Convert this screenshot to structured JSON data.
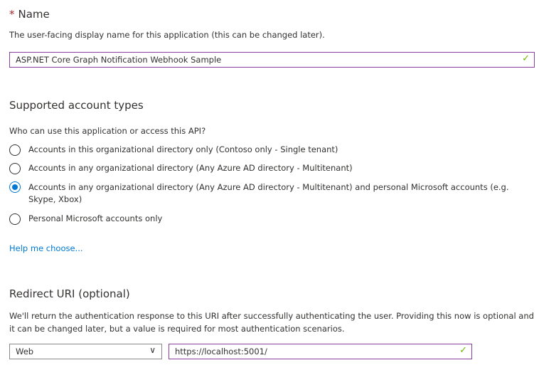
{
  "name_section": {
    "required_mark": "*",
    "title": "Name",
    "description": "The user-facing display name for this application (this can be changed later).",
    "value": "ASP.NET Core Graph Notification Webhook Sample"
  },
  "account_types": {
    "title": "Supported account types",
    "question": "Who can use this application or access this API?",
    "options": [
      {
        "label": "Accounts in this organizational directory only (Contoso only - Single tenant)",
        "selected": false
      },
      {
        "label": "Accounts in any organizational directory (Any Azure AD directory - Multitenant)",
        "selected": false
      },
      {
        "label": "Accounts in any organizational directory (Any Azure AD directory - Multitenant) and personal Microsoft accounts (e.g. Skype, Xbox)",
        "selected": true
      },
      {
        "label": "Personal Microsoft accounts only",
        "selected": false
      }
    ],
    "help_link": "Help me choose..."
  },
  "redirect": {
    "title": "Redirect URI (optional)",
    "description": "We'll return the authentication response to this URI after successfully authenticating the user. Providing this now is optional and it can be changed later, but a value is required for most authentication scenarios.",
    "platform": "Web",
    "uri": "https://localhost:5001/"
  }
}
